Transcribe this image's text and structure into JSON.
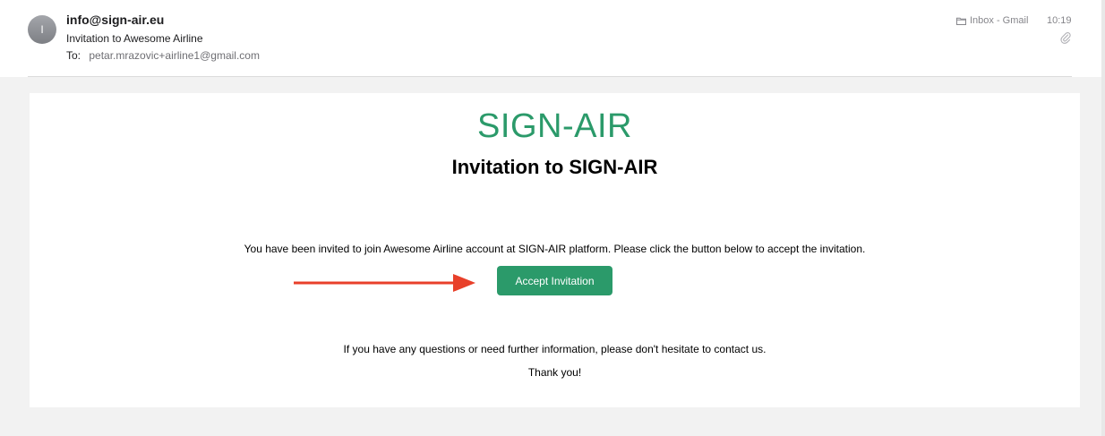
{
  "header": {
    "avatar_initial": "I",
    "from": "info@sign-air.eu",
    "subject": "Invitation to Awesome Airline",
    "to_label": "To:",
    "to_address": "petar.mrazovic+airline1@gmail.com",
    "mailbox": "Inbox - Gmail",
    "time": "10:19",
    "mailbox_icon": "folder-icon",
    "attachment_icon": "paperclip-icon"
  },
  "email": {
    "logo": "SIGN-AIR",
    "title": "Invitation to SIGN-AIR",
    "invite_text": "You have been invited to join Awesome Airline account at SIGN-AIR platform. Please click the button below to accept the invitation.",
    "button_label": "Accept Invitation",
    "questions_text": "If you have any questions or need further information, please don't hesitate to contact us.",
    "thanks_text": "Thank you!"
  },
  "colors": {
    "brand_green": "#2b9a6a",
    "arrow_red": "#e8402a",
    "body_background": "#f2f2f2"
  }
}
